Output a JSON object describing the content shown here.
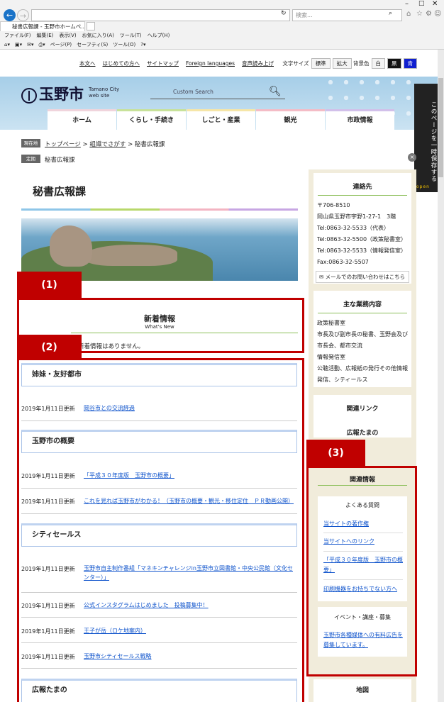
{
  "browser": {
    "address": "",
    "search_placeholder": "検索...",
    "tab_title": "秘書広報課 - 玉野市ホームペ...",
    "menu": [
      "ファイル(F)",
      "編集(E)",
      "表示(V)",
      "お気に入り(A)",
      "ツール(T)",
      "ヘルプ(H)"
    ],
    "commands": [
      "ページ(P)",
      "セーフティ(S)",
      "ツール(O)"
    ]
  },
  "util": {
    "links": [
      "本文へ",
      "はじめての方へ",
      "サイトマップ",
      "Foreign languages",
      "音声読み上げ"
    ],
    "fontsize_label": "文字サイズ",
    "fontsize_btns": [
      "標準",
      "拡大"
    ],
    "bg_label": "背景色",
    "bg_btns": [
      "白",
      "黒",
      "青"
    ]
  },
  "header": {
    "logo_text": "玉野市",
    "logo_sub1": "Tamano City",
    "logo_sub2": "web site",
    "search_placeholder": "Custom Search",
    "nav": [
      "ホーム",
      "くらし・手続き",
      "しごと・産業",
      "観光",
      "市政情報"
    ]
  },
  "sidetab": {
    "label": "このページを一時保存する",
    "open": "open"
  },
  "breadcrumb": {
    "tag1": "現在地",
    "link1": "トップページ",
    "sep": ">",
    "link2": "組織でさがす",
    "current": "秘書広報課",
    "tag2": "定期",
    "fixed": "秘書広報課"
  },
  "page_title": "秘書広報課",
  "annotations": {
    "l1": "(1)",
    "l2": "(2)",
    "l3": "(3)"
  },
  "whatsnew": {
    "title": "新着情報",
    "subtitle": "What's New",
    "empty": "新着情報はありません。"
  },
  "sections": {
    "s1": {
      "title": "姉妹・友好都市",
      "items": [
        {
          "date": "2019年1月11日更新",
          "text": "岡谷市との交流経過"
        }
      ]
    },
    "s2": {
      "title": "玉野市の概要",
      "items": [
        {
          "date": "2019年1月11日更新",
          "text": "「平成３０年度版　玉野市の概要」"
        },
        {
          "date": "2019年1月11日更新",
          "text": "これを見れば玉野市がわかる！（玉野市の概要・観光・移住定住　ＰＲ動画公開）"
        }
      ]
    },
    "s3": {
      "title": "シティセールス",
      "items": [
        {
          "date": "2019年1月11日更新",
          "text": "玉野市自主制作番組「マネキンチャレンジin玉野市立図書館・中央公民館（文化センター）」"
        },
        {
          "date": "2019年1月11日更新",
          "text": "公式インスタグラムはじめました　投稿募集中！"
        },
        {
          "date": "2019年1月11日更新",
          "text": "王子が岳（ロケ地案内）"
        },
        {
          "date": "2019年1月11日更新",
          "text": "玉野市シティセールス戦略"
        }
      ]
    },
    "s4": {
      "title": "広報たまの"
    }
  },
  "sidebar": {
    "contact": {
      "title": "連絡先",
      "lines": [
        "〒706-8510",
        "岡山県玉野市宇野1-27-1　3階",
        "Tel:0863-32-5533（代表）",
        "Tel:0863-32-5500（政策秘書室）",
        "Tel:0863-32-5533（情報発信室）",
        "Fax:0863-32-5507"
      ],
      "mail": "メールでのお問い合わせはこちら"
    },
    "duties": {
      "title": "主な業務内容",
      "lines": [
        "政策秘書室",
        "市長及び副市長の秘書、玉野会及び",
        "市長会、都市交流",
        "情報発信室",
        "公聴活動、広報紙の発行その他情報",
        "発信、シティールス"
      ]
    },
    "related_links": "関連リンク",
    "kouhou": "広報たまの",
    "related_info": {
      "title": "関連情報",
      "faq_head": "よくある質問",
      "faq": [
        "当サイトの著作権",
        "当サイトへのリンク",
        "「平成３０年度版　玉野市の概要」",
        "印刷機器をお持ちでない方へ"
      ],
      "event_head": "イベント・講座・募集",
      "events": [
        "玉野市各種媒体への有料広告を募集しています。"
      ]
    },
    "map": "地図"
  }
}
